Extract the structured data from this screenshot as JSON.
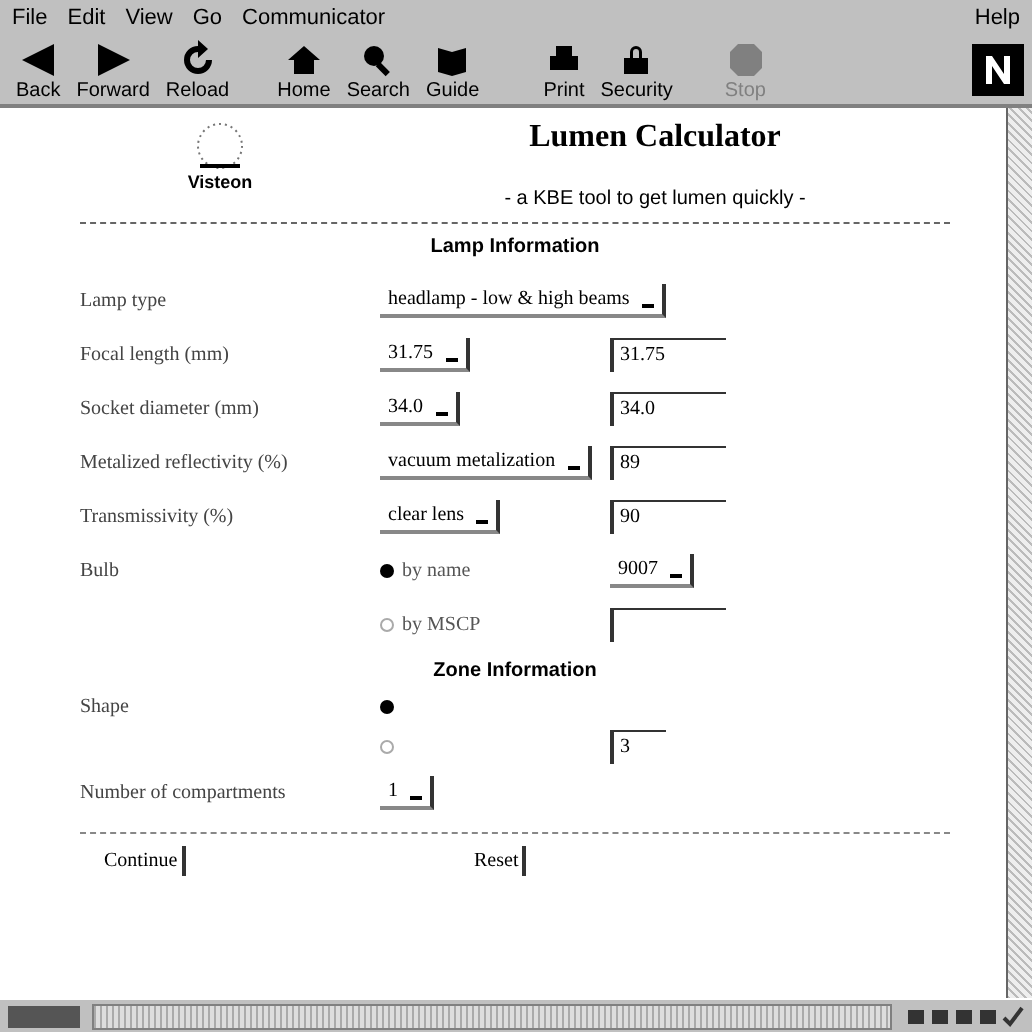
{
  "menu": [
    "File",
    "Edit",
    "View",
    "Go",
    "Communicator"
  ],
  "help": "Help",
  "toolbar": [
    {
      "label": "Back",
      "kind": "back",
      "disabled": false
    },
    {
      "label": "Forward",
      "kind": "forward",
      "disabled": false
    },
    {
      "label": "Reload",
      "kind": "reload",
      "disabled": false
    },
    {
      "label": "Home",
      "kind": "home",
      "disabled": false
    },
    {
      "label": "Search",
      "kind": "search",
      "disabled": false
    },
    {
      "label": "Guide",
      "kind": "guide",
      "disabled": false
    },
    {
      "label": "Print",
      "kind": "print",
      "disabled": false
    },
    {
      "label": "Security",
      "kind": "security",
      "disabled": false
    },
    {
      "label": "Stop",
      "kind": "stop",
      "disabled": true
    }
  ],
  "logo": {
    "name": "Visteon"
  },
  "title": "Lumen Calculator",
  "subtitle": "- a KBE tool to get lumen quickly -",
  "lamp_section": "Lamp Information",
  "rows": [
    {
      "label": "Lamp type",
      "kind": "wide-select",
      "value": "headlamp - low & high beams"
    },
    {
      "label": "Focal length (mm)",
      "kind": "select-field",
      "value": "31.75",
      "field": "31.75"
    },
    {
      "label": "Socket diameter (mm)",
      "kind": "select-field",
      "value": "34.0",
      "field": "34.0"
    },
    {
      "label": "Metalized reflectivity (%)",
      "kind": "select-field",
      "value": "vacuum metalization",
      "field": "89"
    },
    {
      "label": "Transmissivity (%)",
      "kind": "select-field",
      "value": "clear lens",
      "field": "90"
    },
    {
      "label": "Bulb",
      "kind": "radio-select",
      "radio": "by name",
      "selected": true,
      "value": "9007"
    },
    {
      "label": "",
      "kind": "radio-field",
      "radio": "by MSCP",
      "selected": false,
      "field": ""
    }
  ],
  "zone_section": "Zone Information",
  "shape": {
    "label": "Shape",
    "options": [
      {
        "selected": true
      },
      {
        "selected": false,
        "field": "3"
      }
    ]
  },
  "compartments": {
    "label": "Number of compartments",
    "value": "1"
  },
  "buttons": [
    "Continue",
    "Reset"
  ]
}
